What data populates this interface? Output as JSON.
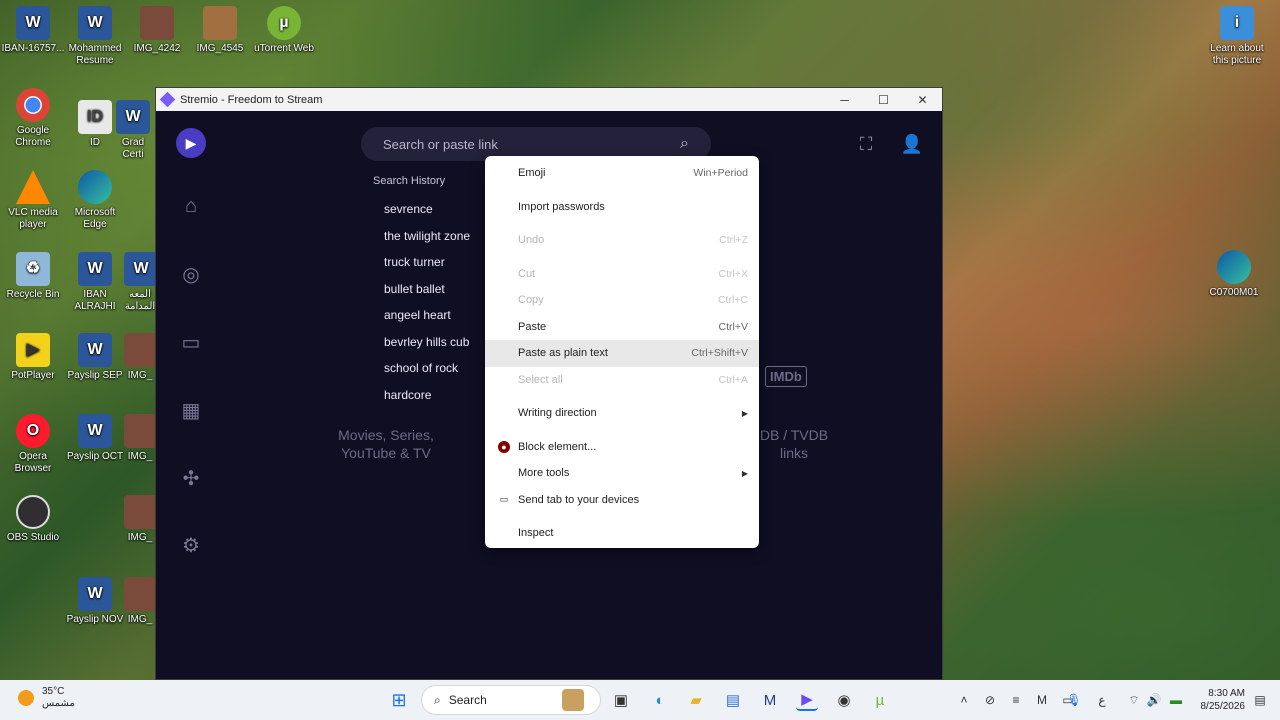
{
  "desktop": {
    "icons": [
      {
        "label": "IBAN-16757...",
        "icon": "word-doc-icon"
      },
      {
        "label": "Mohammed Resume",
        "icon": "word-doc-icon"
      },
      {
        "label": "IMG_4242",
        "icon": "image-icon"
      },
      {
        "label": "IMG_4545",
        "icon": "image-icon"
      },
      {
        "label": "uTorrent Web",
        "icon": "utorrent-icon"
      },
      {
        "label": "Google Chrome",
        "icon": "chrome-icon"
      },
      {
        "label": "ID",
        "icon": "id-card-icon"
      },
      {
        "label": "Grad Certi",
        "icon": "word-doc-icon"
      },
      {
        "label": "VLC media player",
        "icon": "vlc-icon"
      },
      {
        "label": "Microsoft Edge",
        "icon": "edge-icon"
      },
      {
        "label": "Recycle Bin",
        "icon": "recycle-bin-icon"
      },
      {
        "label": "IBAN ALRAJHI",
        "icon": "word-doc-icon"
      },
      {
        "label": "المعه المدامة",
        "icon": "word-doc-icon"
      },
      {
        "label": "PotPlayer",
        "icon": "potplayer-icon"
      },
      {
        "label": "Payslip SEP",
        "icon": "word-doc-icon"
      },
      {
        "label": "IMG_",
        "icon": "image-icon"
      },
      {
        "label": "Opera Browser",
        "icon": "opera-icon"
      },
      {
        "label": "Payslip OCT",
        "icon": "word-doc-icon"
      },
      {
        "label": "IMG_",
        "icon": "image-icon"
      },
      {
        "label": "OBS Studio",
        "icon": "obs-icon"
      },
      {
        "label": "IMG_",
        "icon": "image-icon"
      },
      {
        "label": "Payslip NOV",
        "icon": "word-doc-icon"
      },
      {
        "label": "IMG_",
        "icon": "image-icon"
      },
      {
        "label": "Learn about this picture",
        "icon": "spotlight-icon"
      },
      {
        "label": "C0700M01",
        "icon": "edge-icon"
      }
    ]
  },
  "window": {
    "title": "Stremio - Freedom to Stream",
    "minimize": "─",
    "maximize": "☐",
    "close": "✕"
  },
  "app": {
    "search_placeholder": "Search or paste link",
    "history_header": "Search History",
    "history": [
      "sevrence",
      "the twilight zone",
      "truck turner",
      "bullet ballet",
      "angeel heart",
      "bevrley hills cub",
      "school of rock",
      "hardcore"
    ],
    "promo_left": [
      "Movies, Series,",
      "YouTube & TV"
    ],
    "promo_right": [
      "DB / TVDB",
      "links"
    ],
    "imdb_badge": "IMDb"
  },
  "context_menu": {
    "items": [
      {
        "label": "Emoji",
        "shortcut": "Win+Period",
        "disabled": false
      },
      {
        "label": "Import passwords",
        "shortcut": "",
        "disabled": false
      },
      {
        "label": "Undo",
        "shortcut": "Ctrl+Z",
        "disabled": true
      },
      {
        "label": "Cut",
        "shortcut": "Ctrl+X",
        "disabled": true
      },
      {
        "label": "Copy",
        "shortcut": "Ctrl+C",
        "disabled": true
      },
      {
        "label": "Paste",
        "shortcut": "Ctrl+V",
        "disabled": false
      },
      {
        "label": "Paste as plain text",
        "shortcut": "Ctrl+Shift+V",
        "disabled": false
      },
      {
        "label": "Select all",
        "shortcut": "Ctrl+A",
        "disabled": true
      },
      {
        "label": "Writing direction",
        "shortcut": "",
        "disabled": false
      },
      {
        "label": "Block element...",
        "shortcut": "",
        "disabled": false
      },
      {
        "label": "More tools",
        "shortcut": "",
        "disabled": false
      },
      {
        "label": "Send tab to your devices",
        "shortcut": "",
        "disabled": false
      },
      {
        "label": "Inspect",
        "shortcut": "",
        "disabled": false
      }
    ]
  },
  "taskbar": {
    "temperature": "35°C",
    "weather_desc": "مشمس",
    "search_label": "Search",
    "time": "8:30 AM",
    "date": "8/25/2026",
    "lang": "ع"
  }
}
